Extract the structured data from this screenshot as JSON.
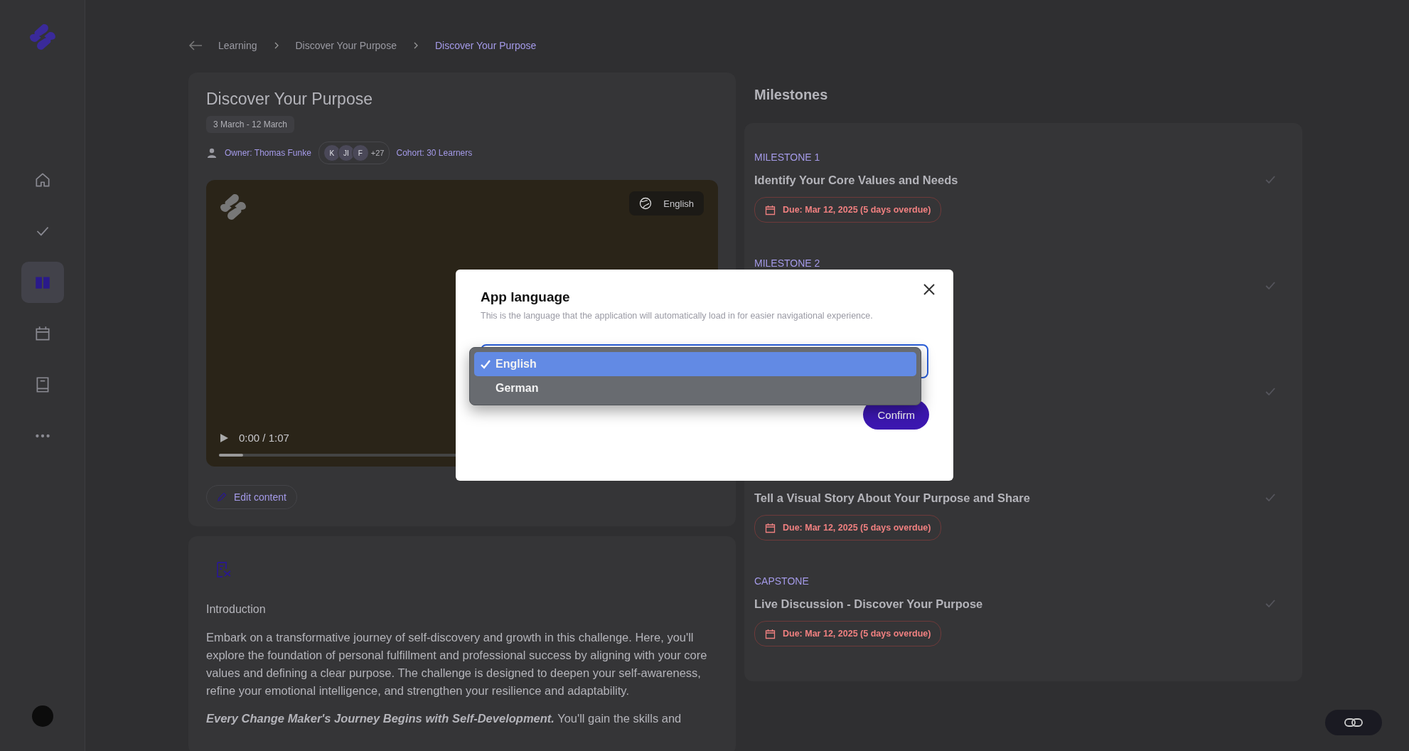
{
  "sidebar": {
    "items": [
      {
        "kind": "home",
        "selected": false
      },
      {
        "kind": "check",
        "selected": false
      },
      {
        "kind": "book",
        "selected": true
      },
      {
        "kind": "calendar",
        "selected": false
      },
      {
        "kind": "notebook",
        "selected": false
      },
      {
        "kind": "more",
        "selected": false
      }
    ]
  },
  "breadcrumb": [
    {
      "label": "Learning",
      "current": false
    },
    {
      "label": "Discover Your Purpose",
      "current": false
    },
    {
      "label": "Discover Your Purpose",
      "current": true
    }
  ],
  "challenge": {
    "title": "Discover Your Purpose",
    "dates": "3 March - 12 March",
    "owner": "Owner: Thomas Funke",
    "avatars": [
      "K",
      "JI",
      "F"
    ],
    "extra_count": "+27",
    "cohort": "Cohort: 30 Learners"
  },
  "video": {
    "language": "English",
    "time": "0:00 / 1:07",
    "level": 0.05
  },
  "edit_button": "Edit content",
  "introduction": {
    "heading": "Introduction",
    "paragraph": "Embark on a transformative journey of self-discovery and growth in this challenge. Here, you'll explore the foundation of personal fulfillment and professional success by aligning with your core values and defining a clear purpose. The challenge is designed to deepen your self-awareness, refine your emotional intelligence, and strengthen your resilience and adaptability.",
    "paragraph_2": "**Every Change Maker's Journey Begins with Self-Development.** You'll gain the skills and"
  },
  "milestones": {
    "title": "Milestones",
    "items": [
      {
        "kind": "milestone",
        "label": "MILESTONE 1",
        "title": "Identify Your Core Values and Needs",
        "due": "Due: Mar 12, 2025 (5 days overdue)"
      },
      {
        "kind": "milestone",
        "label": "MILESTONE 2"
      },
      {
        "kind": "milestone"
      },
      {
        "kind": "milestone",
        "title": "Tell a Visual Story About Your Purpose and Share",
        "due": "Due: Mar 12, 2025 (5 days overdue)"
      },
      {
        "kind": "milestone",
        "label": "CAPSTONE",
        "title": "Live Discussion - Discover Your Purpose",
        "due": "Due: Mar 12, 2025 (5 days overdue)"
      }
    ]
  },
  "language_dialog": {
    "title": "App language",
    "description": "This is the language that the application will automatically load in for easier navigational experience.",
    "options": [
      {
        "label": "English",
        "selected": true
      },
      {
        "label": "German",
        "selected": false
      }
    ],
    "confirm": "Confirm"
  }
}
